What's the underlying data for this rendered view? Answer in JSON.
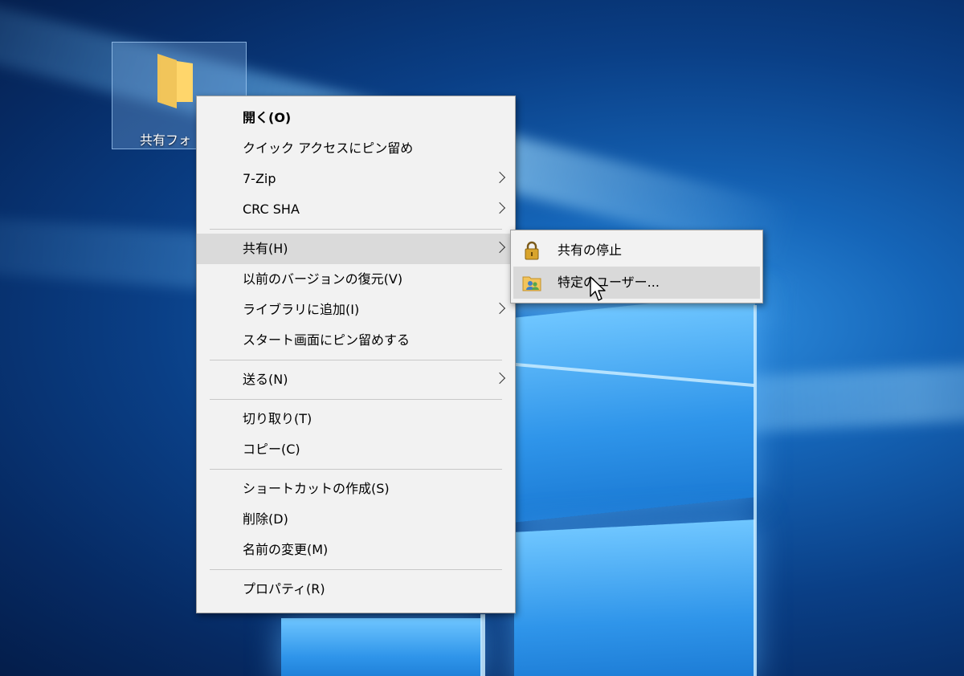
{
  "desktop": {
    "folder_label": "共有フォ"
  },
  "context_menu": {
    "items": [
      {
        "label": "開く(O)"
      },
      {
        "label": "クイック アクセスにピン留め"
      },
      {
        "label": "7-Zip"
      },
      {
        "label": "CRC SHA"
      },
      {
        "label": "共有(H)"
      },
      {
        "label": "以前のバージョンの復元(V)"
      },
      {
        "label": "ライブラリに追加(I)"
      },
      {
        "label": "スタート画面にピン留めする"
      },
      {
        "label": "送る(N)"
      },
      {
        "label": "切り取り(T)"
      },
      {
        "label": "コピー(C)"
      },
      {
        "label": "ショートカットの作成(S)"
      },
      {
        "label": "削除(D)"
      },
      {
        "label": "名前の変更(M)"
      },
      {
        "label": "プロパティ(R)"
      }
    ]
  },
  "share_submenu": {
    "items": [
      {
        "label": "共有の停止",
        "icon": "lock-icon"
      },
      {
        "label": "特定のユーザー...",
        "icon": "users-folder-icon"
      }
    ]
  },
  "colors": {
    "menu_background": "#f2f2f2",
    "highlight": "#dadada",
    "desktop_blue": "#0a3f86"
  }
}
